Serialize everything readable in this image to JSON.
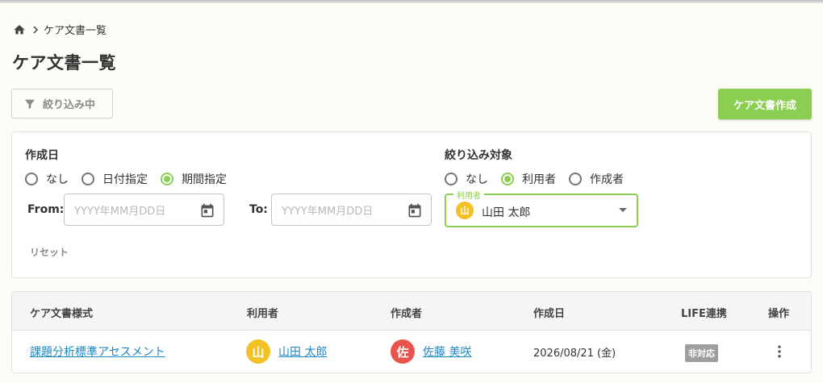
{
  "breadcrumb": {
    "current": "ケア文書一覧"
  },
  "page": {
    "title": "ケア文書一覧"
  },
  "toolbar": {
    "filter_label": "絞り込み中",
    "create_label": "ケア文書作成"
  },
  "filter": {
    "date": {
      "label": "作成日",
      "options": [
        "なし",
        "日付指定",
        "期間指定"
      ],
      "selected": "期間指定",
      "from_label": "From:",
      "to_label": "To:",
      "from_placeholder": "YYYY年MM月DD日",
      "to_placeholder": "YYYY年MM月DD日"
    },
    "target": {
      "label": "絞り込み対象",
      "options": [
        "なし",
        "利用者",
        "作成者"
      ],
      "selected": "利用者",
      "user_field_label": "利用者",
      "user_avatar": "山",
      "user_name": "山田 太郎"
    },
    "reset_label": "リセット"
  },
  "table": {
    "headers": [
      "ケア文書様式",
      "利用者",
      "作成者",
      "作成日",
      "LIFE連携",
      "操作"
    ],
    "rows": [
      {
        "form": "課題分析標準アセスメント",
        "user_avatar": "山",
        "user_name": "山田 太郎",
        "author_avatar": "佐",
        "author_name": "佐藤 美咲",
        "created": "2026/08/21 (金)",
        "life": "非対応"
      }
    ]
  },
  "colors": {
    "accent": "#8bce52",
    "link": "#1e88c5",
    "avatar_user": "#f3c025",
    "avatar_author": "#e8544d"
  }
}
